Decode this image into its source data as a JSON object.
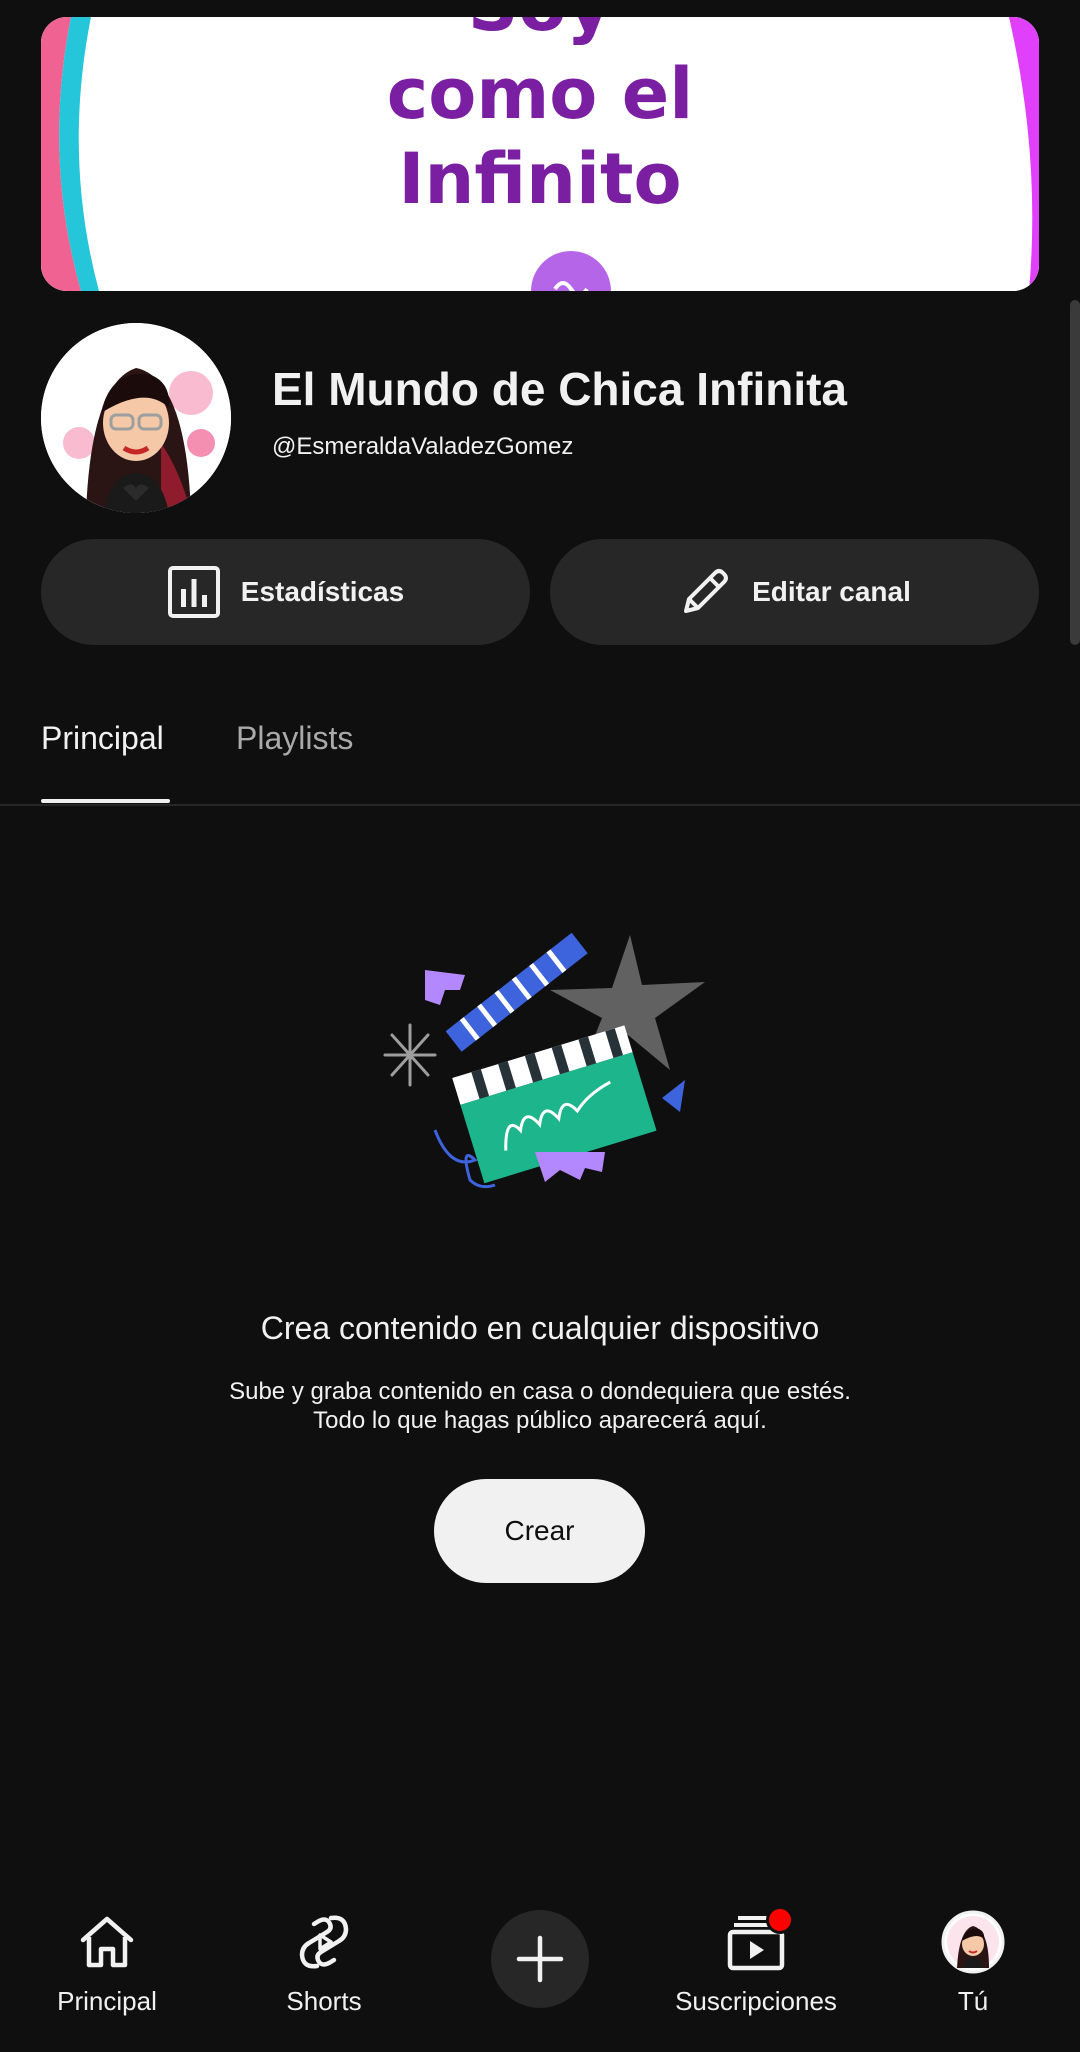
{
  "banner": {
    "line_partial": "Soy",
    "line1": "como el",
    "line2": "Infinito"
  },
  "channel": {
    "name": "El Mundo de Chica Infinita",
    "handle": "@EsmeraldaValadezGomez"
  },
  "actions": {
    "stats_label": "Estadísticas",
    "edit_label": "Editar canal"
  },
  "tabs": [
    {
      "label": "Principal",
      "active": true
    },
    {
      "label": "Playlists",
      "active": false
    }
  ],
  "empty_state": {
    "title": "Crea contenido en cualquier dispositivo",
    "description_line1": "Sube y graba contenido en casa o dondequiera que estés.",
    "description_line2": "Todo lo que hagas público aparecerá aquí.",
    "create_label": "Crear"
  },
  "bottom_nav": {
    "items": [
      {
        "label": "Principal",
        "icon": "home-icon"
      },
      {
        "label": "Shorts",
        "icon": "shorts-icon"
      },
      {
        "label": "",
        "icon": "plus-icon"
      },
      {
        "label": "Suscripciones",
        "icon": "subscriptions-icon",
        "notification": true
      },
      {
        "label": "Tú",
        "icon": "avatar-icon"
      }
    ]
  },
  "colors": {
    "background": "#0f0f0f",
    "surface": "#272727",
    "text": "#f1f1f1",
    "text_secondary": "#aaaaaa",
    "banner_text": "#7a1fa2",
    "notification": "#ff0000"
  }
}
